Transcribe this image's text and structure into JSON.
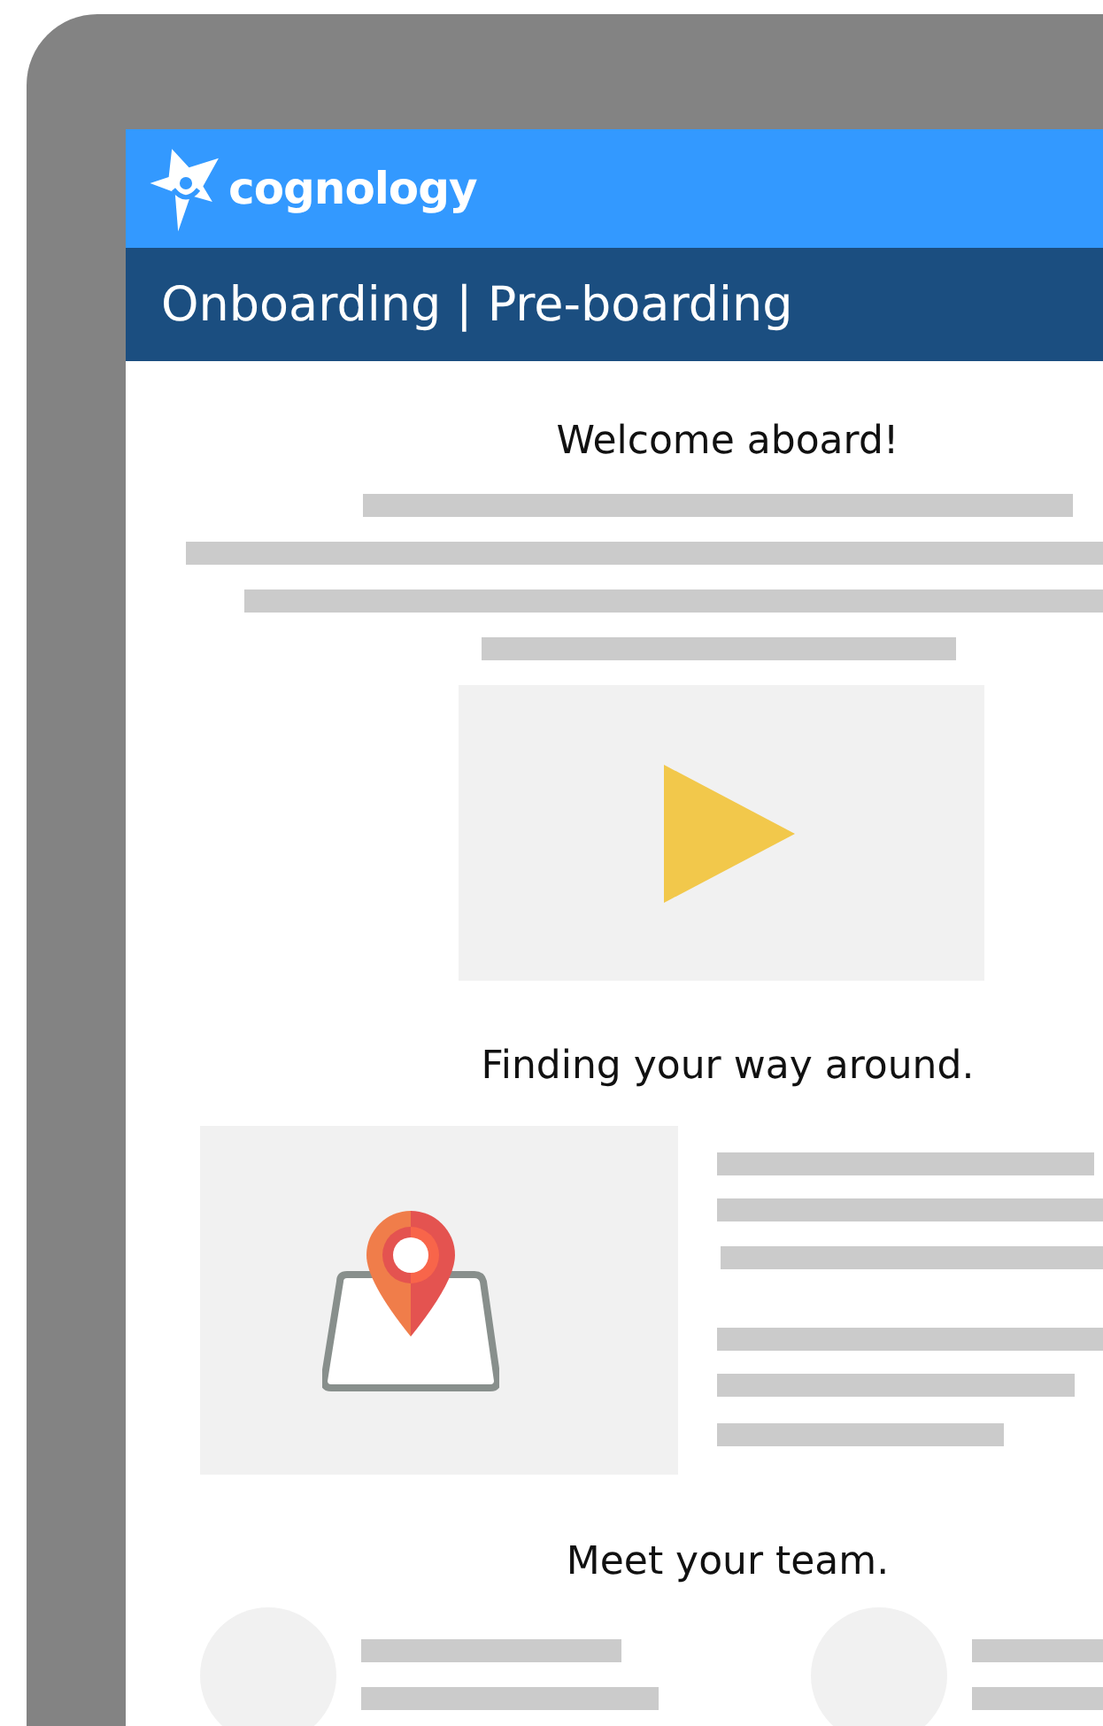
{
  "header": {
    "logo_text": "cognology",
    "title": "Onboarding | Pre-boarding"
  },
  "sections": [
    {
      "kind": "video",
      "heading": "Welcome aboard!"
    },
    {
      "kind": "map",
      "heading": "Finding your way around."
    },
    {
      "kind": "team",
      "heading": "Meet your team."
    }
  ]
}
